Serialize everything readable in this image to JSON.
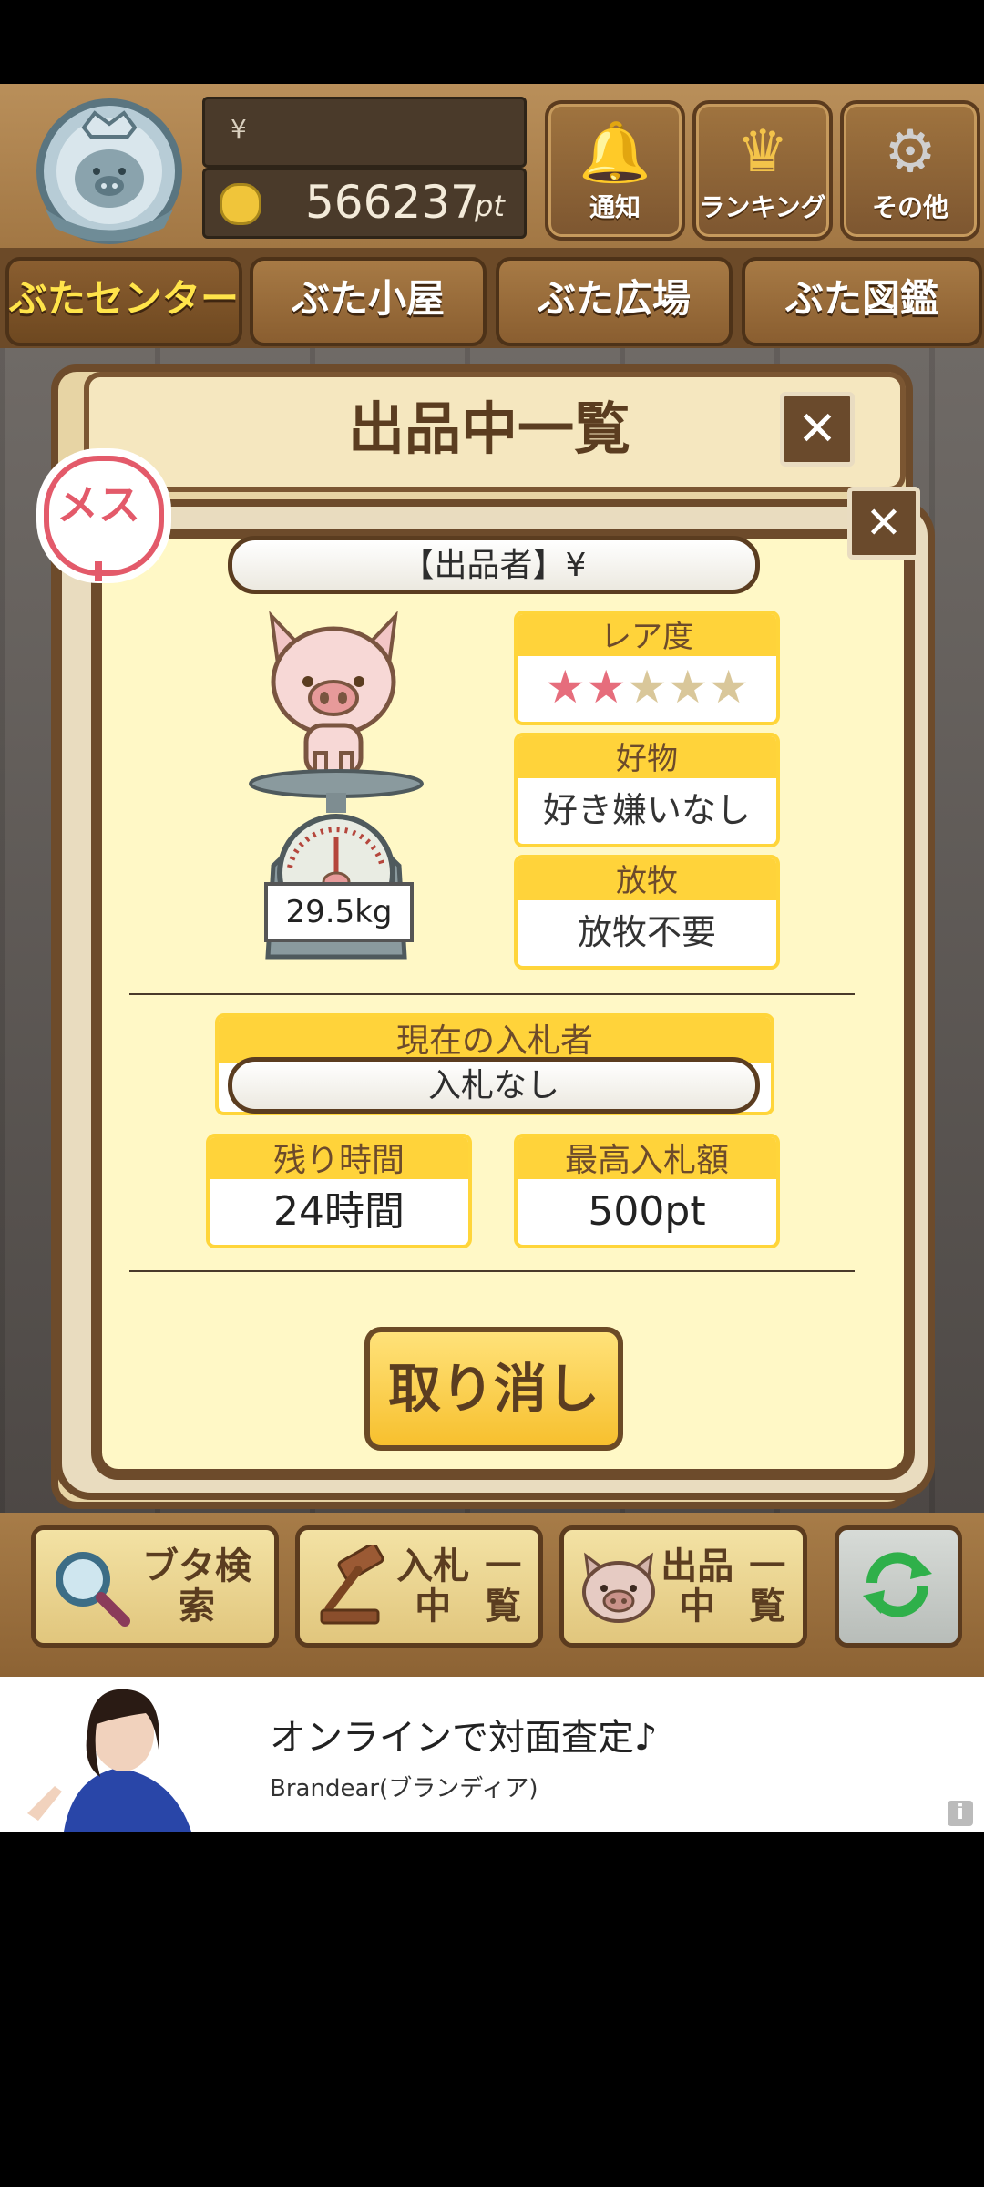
{
  "header": {
    "currency_symbol": "¥",
    "points": "566237",
    "points_unit": "pt",
    "buttons": [
      {
        "label": "通知",
        "icon": "bell-icon"
      },
      {
        "label": "ランキング",
        "icon": "crown-icon"
      },
      {
        "label": "その他",
        "icon": "gear-icon"
      }
    ]
  },
  "nav": {
    "tabs": [
      "ぶたセンター",
      "ぶた小屋",
      "ぶた広場",
      "ぶた図鑑"
    ],
    "active_index": 0
  },
  "panel": {
    "title": "出品中一覧",
    "close_symbol": "✕"
  },
  "card": {
    "gender_label": "メス",
    "seller_label": "【出品者】¥",
    "weight": "29.5kg",
    "rarity": {
      "label": "レア度",
      "stars_on": 2,
      "stars_total": 5,
      "star_char": "★"
    },
    "favorite": {
      "label": "好物",
      "value": "好き嫌いなし"
    },
    "grazing": {
      "label": "放牧",
      "value": "放牧不要"
    },
    "current_bidder": {
      "label": "現在の入札者",
      "value": "入札なし"
    },
    "time_left": {
      "label": "残り時間",
      "value": "24時間"
    },
    "highest_bid": {
      "label": "最高入札額",
      "value": "500pt"
    },
    "cancel_label": "取り消し",
    "close_symbol": "✕"
  },
  "toolbar": {
    "search_label": "ブタ検索",
    "bidding_label_1": "入札中",
    "bidding_label_2": "一覧",
    "listing_label_1": "出品中",
    "listing_label_2": "一覧"
  },
  "ad": {
    "title": "オンラインで対面査定♪",
    "brand": "Brandear(ブランディア)",
    "info": "i"
  },
  "colors": {
    "accent_yellow": "#ffd33a",
    "wood_dark": "#6d4b2b",
    "card_bg": "#fff8c6",
    "star_on": "#e66d7c",
    "gender_pink": "#e35a6a"
  }
}
